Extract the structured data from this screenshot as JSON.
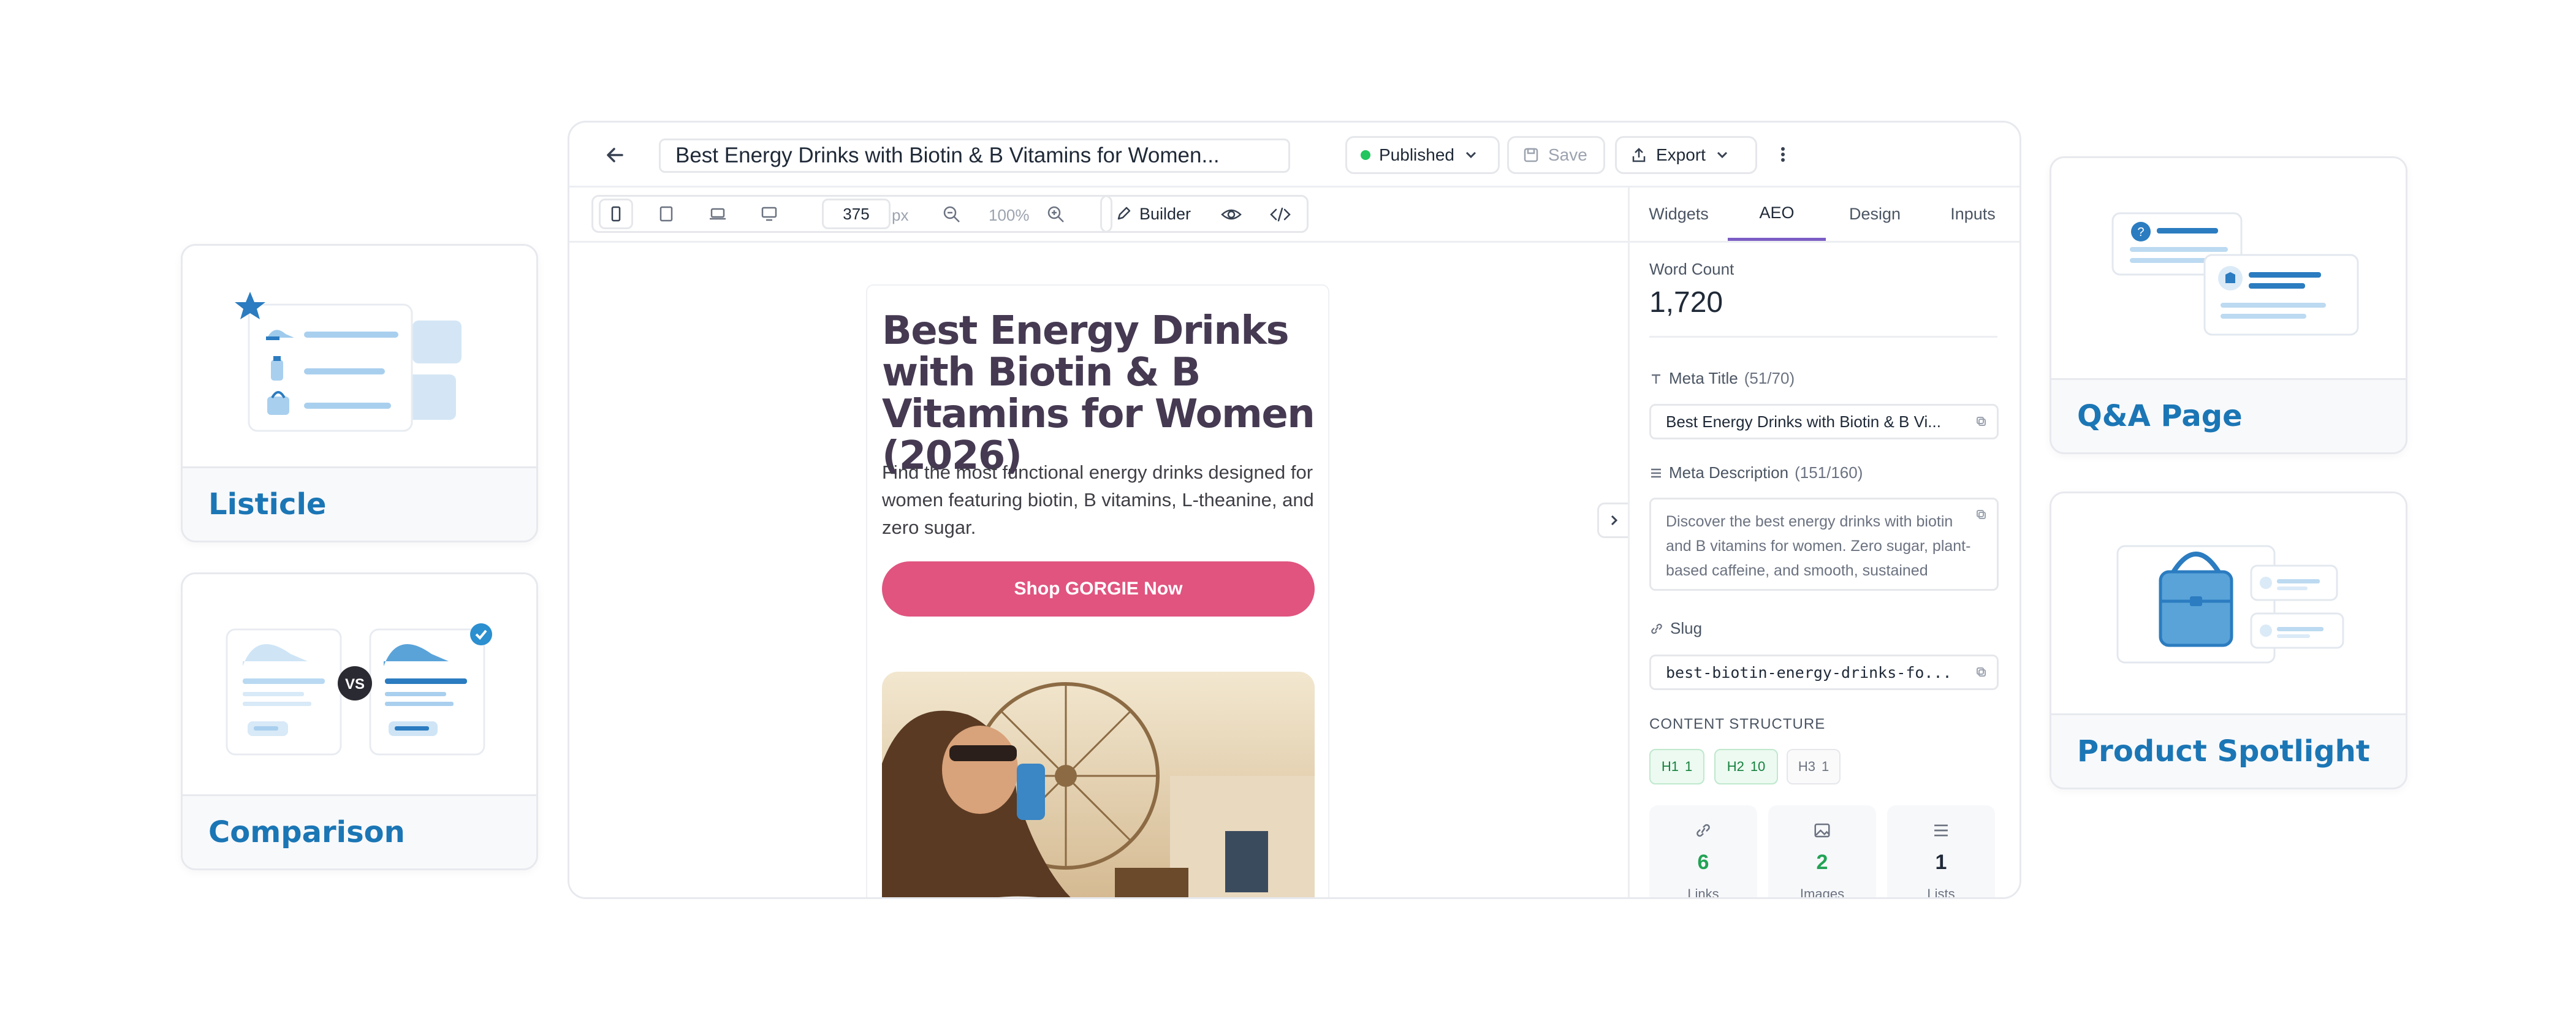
{
  "templates": {
    "listicle": "Listicle",
    "comparison": "Comparison",
    "vs": "VS",
    "qa": "Q&A Page",
    "product": "Product Spotlight"
  },
  "header": {
    "title": "Best Energy Drinks with Biotin & B Vitamins for Women...",
    "status": "Published",
    "save": "Save",
    "export": "Export"
  },
  "toolbar": {
    "width_value": "375",
    "width_unit": "px",
    "zoom": "100%",
    "builder": "Builder"
  },
  "article": {
    "title": "Best Energy Drinks with Biotin & B Vitamins for Women (2026)",
    "intro": "Find the most functional energy drinks designed for women featuring biotin, B vitamins, L-theanine, and zero sugar.",
    "cta": "Shop GORGIE Now"
  },
  "panel": {
    "tabs": [
      "Widgets",
      "AEO",
      "Design",
      "Inputs"
    ],
    "active_tab": "AEO",
    "word_count_label": "Word Count",
    "word_count": "1,720",
    "meta_title_label": "Meta Title",
    "meta_title_count": "(51/70)",
    "meta_title_value": "Best Energy Drinks with Biotin & B Vi...",
    "meta_desc_label": "Meta Description",
    "meta_desc_count": "(151/160)",
    "meta_desc_value": "Discover the best energy drinks with biotin and B vitamins for women. Zero sugar, plant-based caffeine, and smooth, sustained energy.",
    "slug_label": "Slug",
    "slug_value": "best-biotin-energy-drinks-fo...",
    "structure_label": "CONTENT STRUCTURE",
    "headings": [
      {
        "tag": "H1",
        "count": "1"
      },
      {
        "tag": "H2",
        "count": "10"
      },
      {
        "tag": "H3",
        "count": "1"
      }
    ],
    "stats": [
      {
        "value": "6",
        "label": "Links"
      },
      {
        "value": "2",
        "label": "Images"
      },
      {
        "value": "1",
        "label": "Lists"
      }
    ]
  },
  "colors": {
    "accent": "#1b76b5",
    "active_tab": "#7c5cc4",
    "cta": "#e0547f",
    "published_dot": "#22c55e",
    "title_text": "#453a52"
  }
}
